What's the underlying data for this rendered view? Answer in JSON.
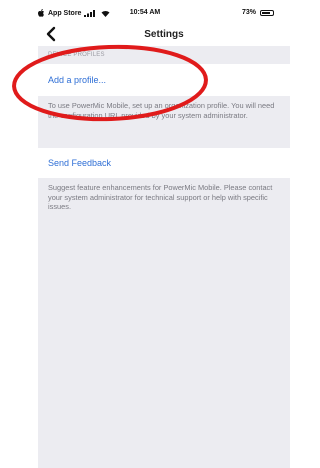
{
  "status_bar": {
    "carrier": "App Store",
    "time": "10:54 AM",
    "battery": "73%"
  },
  "nav": {
    "title": "Settings"
  },
  "profiles_section": {
    "header": "DEVICE PROFILES",
    "add_profile_label": "Add a profile...",
    "footer": "To use PowerMic Mobile, set up an organization profile. You will need the configuration URL provided by your system administrator."
  },
  "feedback_section": {
    "send_feedback_label": "Send Feedback",
    "footer": "Suggest feature enhancements for PowerMic Mobile. Please contact your system administrator for technical support or help with specific issues."
  },
  "annotation": {
    "color": "#e01b1b"
  }
}
